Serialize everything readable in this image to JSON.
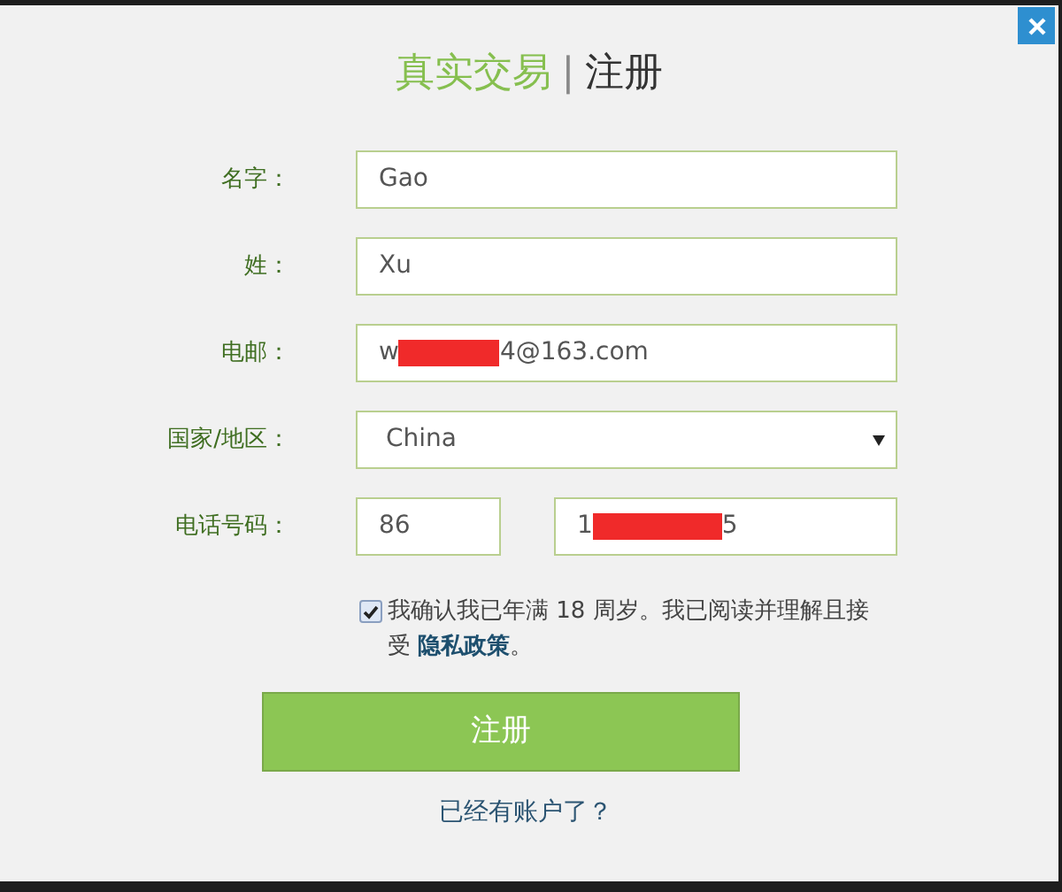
{
  "title": {
    "brand": "真实交易",
    "separator": "|",
    "page": "注册"
  },
  "fields": [
    {
      "kind": "text",
      "label": "名字：",
      "value": "Gao"
    },
    {
      "kind": "text",
      "label": "姓：",
      "value": "Xu"
    },
    {
      "kind": "redacted",
      "label": "电邮：",
      "before": "w",
      "after": "4@163.com"
    },
    {
      "kind": "select",
      "label": "国家/地区：",
      "value": "China"
    },
    {
      "kind": "phone",
      "label": "电话号码：",
      "code": "86",
      "before": "1",
      "after": "5"
    }
  ],
  "consent": {
    "checked": true,
    "text": "我确认我已年满 18 周岁。我已阅读并理解且接受 ",
    "link": "隐私政策",
    "end": "。"
  },
  "submit": "注册",
  "login_link": "已经有账户了？"
}
